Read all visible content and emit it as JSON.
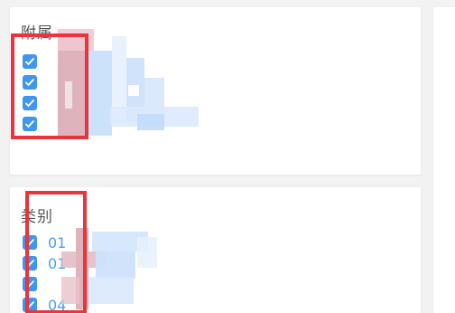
{
  "sections": {
    "attachment": {
      "title": "附属",
      "options": [
        {
          "label": "",
          "checked": true
        },
        {
          "label": "",
          "checked": true
        },
        {
          "label": "",
          "checked": true
        },
        {
          "label": "",
          "checked": true
        }
      ]
    },
    "category": {
      "title": "类别",
      "options": [
        {
          "label": "01",
          "checked": true
        },
        {
          "label": "01",
          "checked": true
        },
        {
          "label": "",
          "checked": true
        },
        {
          "label": "04",
          "checked": true
        }
      ]
    }
  },
  "colors": {
    "checkbox": "#4096ee",
    "label": "#4aa0f0",
    "annotation": "#e8343a",
    "background": "#f2f2f2"
  },
  "icons": {
    "checkmark": "check-icon"
  }
}
